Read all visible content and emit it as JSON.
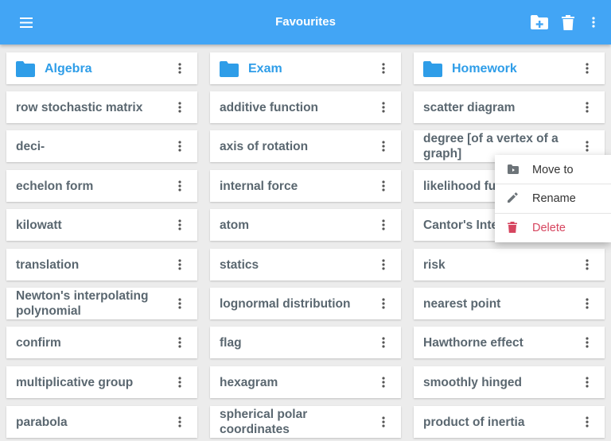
{
  "appbar": {
    "title": "Favourites",
    "icons": [
      "menu-icon",
      "new-folder-icon",
      "trash-icon",
      "overflow-menu-icon"
    ]
  },
  "columns": [
    {
      "folder": "Algebra",
      "items": [
        "row stochastic matrix",
        "deci-",
        "echelon form",
        "kilowatt",
        "translation",
        "Newton's interpolating polynomial",
        "confirm",
        "multiplicative group",
        "parabola"
      ]
    },
    {
      "folder": "Exam",
      "items": [
        "additive function",
        "axis of rotation",
        "internal force",
        "atom",
        "statics",
        "lognormal distribution",
        "flag",
        "hexagram",
        "spherical polar coordinates"
      ]
    },
    {
      "folder": "Homework",
      "items": [
        "scatter diagram",
        "degree [of a vertex of a graph]",
        "likelihood fu",
        "Cantor's Inte Theorem",
        "risk",
        "nearest point",
        "Hawthorne effect",
        "smoothly hinged",
        "product of inertia"
      ]
    }
  ],
  "context_menu": {
    "items": [
      {
        "label": "Move to",
        "icon": "move-to-folder-icon"
      },
      {
        "label": "Rename",
        "icon": "pencil-icon"
      },
      {
        "label": "Delete",
        "icon": "trash-icon"
      }
    ]
  },
  "colors": {
    "appbar": "#42a5f5",
    "folder": "#2e9de8",
    "text": "#5a6770",
    "delete": "#d6455f",
    "background": "#ececec"
  }
}
